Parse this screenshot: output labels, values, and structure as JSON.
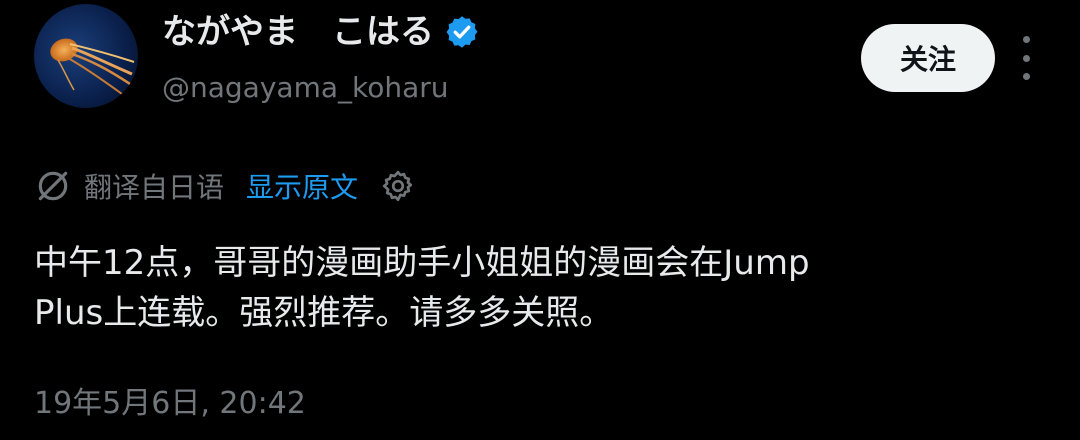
{
  "user": {
    "display_name": "ながやま　こはる",
    "handle": "@nagayama_koharu",
    "verified": true,
    "avatar": "jellyfish-photo"
  },
  "actions": {
    "follow_label": "关注",
    "more_icon": "vertical-ellipsis-icon"
  },
  "translation": {
    "icon": "translate-icon",
    "label": "翻译自日语",
    "show_original_label": "显示原文",
    "settings_icon": "gear-icon"
  },
  "tweet": {
    "line1": "中午12点，哥哥的漫画助手小姐姐的漫画会在Jump",
    "line2": "Plus上连载。强烈推荐。请多多关照。",
    "timestamp": "19年5月6日, 20:42"
  },
  "colors": {
    "background": "#000000",
    "text": "#e7e9ea",
    "muted": "#71767b",
    "link": "#1d9bf0",
    "verified": "#1d9bf0",
    "follow_bg": "#eff3f4"
  }
}
